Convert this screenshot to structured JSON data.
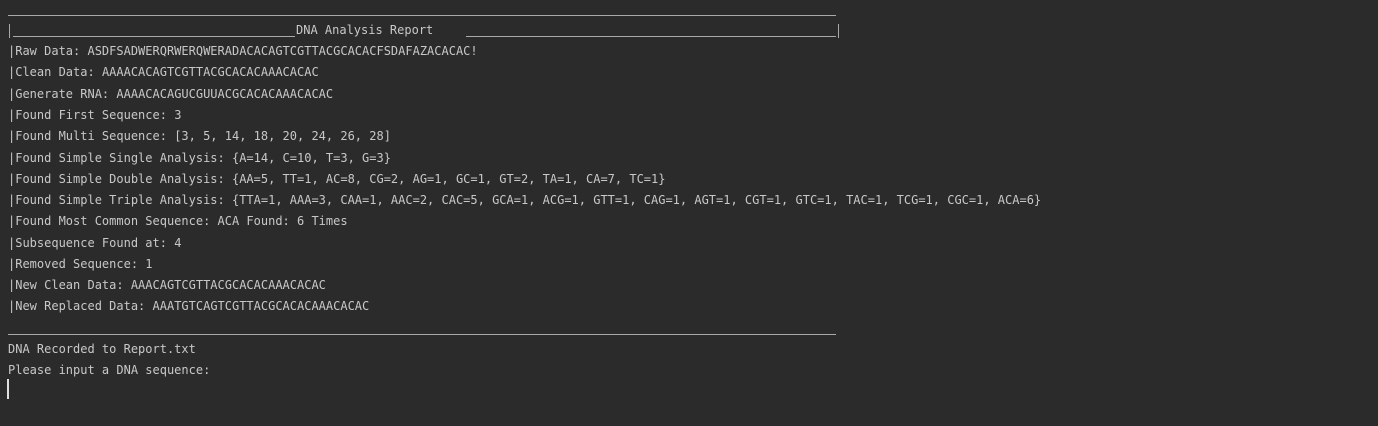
{
  "report": {
    "title": "DNA Analysis Report",
    "lines": [
      {
        "label": "Raw Data: ",
        "value": "ASDFSADWERQRWERQWERADACACAGTCGTTACGCACACFSDAFAZACACAC!"
      },
      {
        "label": "Clean Data: ",
        "value": "AAAACACAGTCGTTACGCACACAAACACAC"
      },
      {
        "label": "Generate RNA: ",
        "value": "AAAACACAGUCGUUACGCACACAAACACAC"
      },
      {
        "label": "Found First Sequence: ",
        "value": "3"
      },
      {
        "label": "Found Multi Sequence: ",
        "value": "[3, 5, 14, 18, 20, 24, 26, 28]"
      },
      {
        "label": "Found Simple Single Analysis: ",
        "value": "{A=14, C=10, T=3, G=3}"
      },
      {
        "label": "Found Simple Double Analysis: ",
        "value": "{AA=5, TT=1, AC=8, CG=2, AG=1, GC=1, GT=2, TA=1, CA=7, TC=1}"
      },
      {
        "label": "Found Simple Triple Analysis: ",
        "value": "{TTA=1, AAA=3, CAA=1, AAC=2, CAC=5, GCA=1, ACG=1, GTT=1, CAG=1, AGT=1, CGT=1, GTC=1, TAC=1, TCG=1, CGC=1, ACA=6}"
      },
      {
        "label": "Found Most Common Sequence: ",
        "value": "ACA Found: 6 Times"
      },
      {
        "label": "Subsequence Found at: ",
        "value": "4"
      },
      {
        "label": "Removed Sequence: ",
        "value": "1"
      },
      {
        "label": "New Clean Data: ",
        "value": "AAACAGTCGTTACGCACACAAACACAC"
      },
      {
        "label": "New Replaced Data: ",
        "value": "AAATGTCAGTCGTTACGCACACAAACACAC"
      }
    ]
  },
  "status": {
    "recorded": "DNA Recorded to Report.txt",
    "prompt": "Please input a DNA sequence:"
  }
}
